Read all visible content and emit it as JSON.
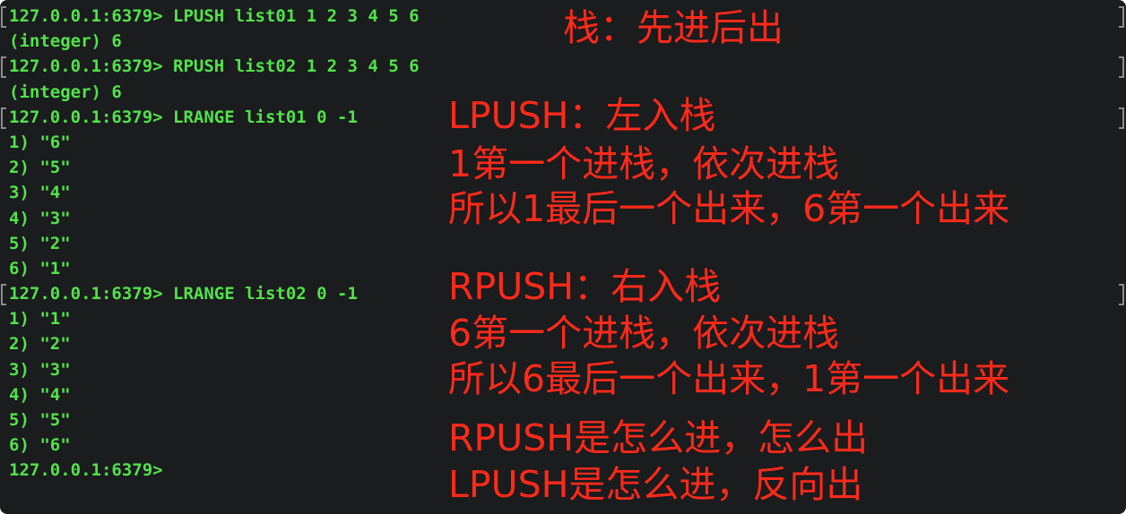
{
  "terminal": {
    "lines": [
      {
        "text": "127.0.0.1:6379> LPUSH list01 1 2 3 4 5 6",
        "bracket_left": true,
        "bracket_right": true
      },
      {
        "text": "(integer) 6",
        "bracket_left": false,
        "bracket_right": false
      },
      {
        "text": "127.0.0.1:6379> RPUSH list02 1 2 3 4 5 6",
        "bracket_left": true,
        "bracket_right": true
      },
      {
        "text": "(integer) 6",
        "bracket_left": false,
        "bracket_right": false
      },
      {
        "text": "127.0.0.1:6379> LRANGE list01 0 -1",
        "bracket_left": true,
        "bracket_right": true
      },
      {
        "text": "1) \"6\"",
        "bracket_left": false,
        "bracket_right": false
      },
      {
        "text": "2) \"5\"",
        "bracket_left": false,
        "bracket_right": false
      },
      {
        "text": "3) \"4\"",
        "bracket_left": false,
        "bracket_right": false
      },
      {
        "text": "4) \"3\"",
        "bracket_left": false,
        "bracket_right": false
      },
      {
        "text": "5) \"2\"",
        "bracket_left": false,
        "bracket_right": false
      },
      {
        "text": "6) \"1\"",
        "bracket_left": false,
        "bracket_right": false
      },
      {
        "text": "127.0.0.1:6379> LRANGE list02 0 -1",
        "bracket_left": true,
        "bracket_right": true
      },
      {
        "text": "1) \"1\"",
        "bracket_left": false,
        "bracket_right": false
      },
      {
        "text": "2) \"2\"",
        "bracket_left": false,
        "bracket_right": false
      },
      {
        "text": "3) \"3\"",
        "bracket_left": false,
        "bracket_right": false
      },
      {
        "text": "4) \"4\"",
        "bracket_left": false,
        "bracket_right": false
      },
      {
        "text": "5) \"5\"",
        "bracket_left": false,
        "bracket_right": false
      },
      {
        "text": "6) \"6\"",
        "bracket_left": false,
        "bracket_right": false
      },
      {
        "text": "127.0.0.1:6379>",
        "bracket_left": false,
        "bracket_right": false
      }
    ]
  },
  "annotations": {
    "title": "栈：先进后出",
    "lpush_heading": "LPUSH：左入栈",
    "lpush_line1": "1第一个进栈，依次进栈",
    "lpush_line2": "所以1最后一个出来，6第一个出来",
    "rpush_heading": "RPUSH：右入栈",
    "rpush_line1": "6第一个进栈，依次进栈",
    "rpush_line2": "所以6最后一个出来，1第一个出来",
    "summary_rpush": "RPUSH是怎么进，怎么出",
    "summary_lpush": "LPUSH是怎么进，反向出"
  },
  "colors": {
    "terminal_bg": "#1a1c1e",
    "terminal_text": "#52e34a",
    "annotation_text": "#ff2a1a",
    "bracket": "#8a8d90"
  }
}
